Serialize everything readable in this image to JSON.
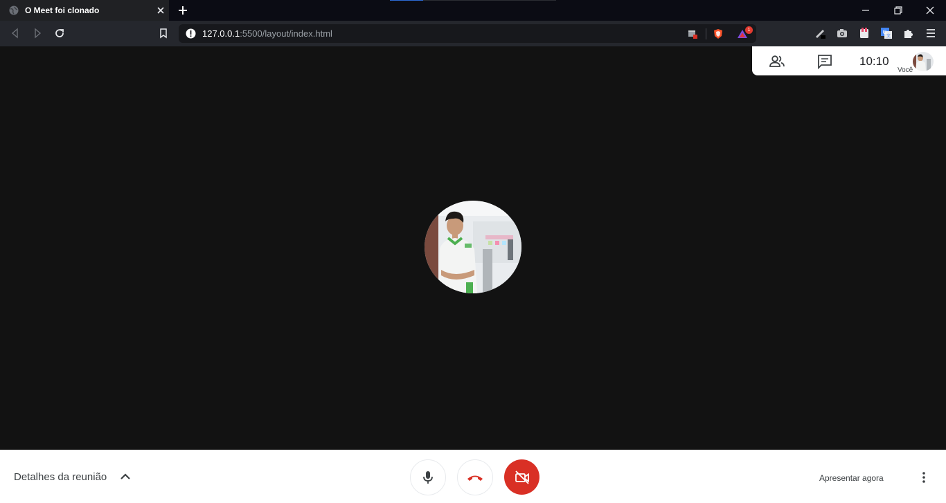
{
  "browser": {
    "tab_title": "O Meet foi clonado",
    "url_host": "127.0.0.1",
    "url_rest": ":5500/layout/index.html",
    "ad_blocker_badge": "1"
  },
  "meet": {
    "clock": "10:10",
    "self_label": "Você",
    "meeting_details_label": "Detalhes da reunião",
    "present_label": "Apresentar agora",
    "camera_off": true,
    "colors": {
      "hangup_red": "#d93025",
      "stage_bg": "#121212"
    }
  }
}
